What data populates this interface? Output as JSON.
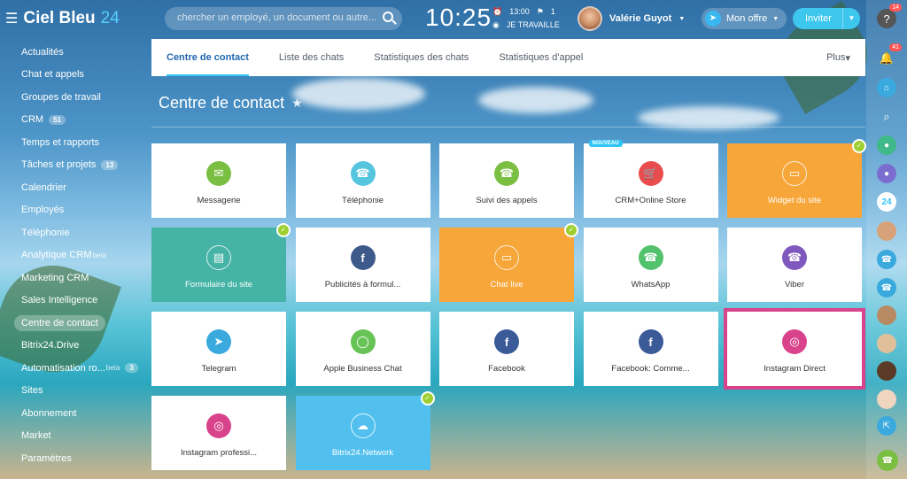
{
  "app": {
    "logo_text": "Ciel Bleu",
    "logo_num": "24"
  },
  "search": {
    "placeholder": "chercher un employé, un document ou autre..."
  },
  "clock": {
    "time": "10:25",
    "alarm": "13:00",
    "flag": "1",
    "status": "JE TRAVAILLE"
  },
  "user": {
    "name": "Valérie Guyot"
  },
  "header": {
    "offer_label": "Mon offre",
    "invite_label": "Inviter"
  },
  "sidebar": {
    "items": [
      {
        "label": "Actualités"
      },
      {
        "label": "Chat et appels"
      },
      {
        "label": "Groupes de travail"
      },
      {
        "label": "CRM",
        "count": "51"
      },
      {
        "label": "Temps et rapports"
      },
      {
        "label": "Tâches et projets",
        "count": "13"
      },
      {
        "label": "Calendrier"
      },
      {
        "label": "Employés"
      },
      {
        "label": "Téléphonie"
      },
      {
        "label": "Analytique CRM",
        "beta": "beta"
      },
      {
        "label": "Marketing CRM"
      },
      {
        "label": "Sales Intelligence"
      },
      {
        "label": "Centre de contact"
      },
      {
        "label": "Bitrix24.Drive"
      },
      {
        "label": "Automatisation ro...",
        "beta": "beta",
        "count": "3"
      },
      {
        "label": "Sites"
      },
      {
        "label": "Abonnement"
      },
      {
        "label": "Market"
      },
      {
        "label": "Paramètres"
      }
    ]
  },
  "tabs": [
    {
      "label": "Centre de contact"
    },
    {
      "label": "Liste des chats"
    },
    {
      "label": "Statistiques des chats"
    },
    {
      "label": "Statistiques d'appel"
    },
    {
      "label": "Plus"
    }
  ],
  "page": {
    "title": "Centre de contact"
  },
  "tiles": [
    {
      "label": "Messagerie",
      "icon": "envelope-icon",
      "color": "#7bbf42"
    },
    {
      "label": "Téléphonie",
      "icon": "phone-icon",
      "color": "#55c6de"
    },
    {
      "label": "Suivi des appels",
      "icon": "call-tracking-icon",
      "color": "#7bbf42"
    },
    {
      "label": "CRM+Online Store",
      "icon": "cart-icon",
      "color": "#e84c4c",
      "tag": "NOUVEAU"
    },
    {
      "label": "Widget du site",
      "icon": "chat-bubbles-icon",
      "style": "orange",
      "connected": true
    },
    {
      "label": "Formulaire du site",
      "icon": "form-icon",
      "style": "teal",
      "connected": true
    },
    {
      "label": "Publicités à formul...",
      "icon": "ad-form-icon",
      "color": "#3d5a8a"
    },
    {
      "label": "Chat live",
      "icon": "chat-icon",
      "style": "orange",
      "connected": true
    },
    {
      "label": "WhatsApp",
      "icon": "whatsapp-icon",
      "color": "#52c26d"
    },
    {
      "label": "Viber",
      "icon": "viber-icon",
      "color": "#7f58bd"
    },
    {
      "label": "Telegram",
      "icon": "telegram-icon",
      "color": "#39a9de"
    },
    {
      "label": "Apple Business Chat",
      "icon": "message-icon",
      "color": "#68c356"
    },
    {
      "label": "Facebook",
      "icon": "facebook-icon",
      "color": "#3b5a98"
    },
    {
      "label": "Facebook: Comme...",
      "icon": "facebook-comments-icon",
      "color": "#3b5a98"
    },
    {
      "label": "Instagram Direct",
      "icon": "instagram-direct-icon",
      "color": "#d9438c",
      "selected": true
    },
    {
      "label": "Instagram professi...",
      "icon": "instagram-icon",
      "color": "#d9438c"
    },
    {
      "label": "Bitrix24.Network",
      "icon": "cloud-icon",
      "style": "blue",
      "connected": true
    }
  ],
  "rightbar": {
    "notif_count": "14",
    "bell_count": "41"
  }
}
